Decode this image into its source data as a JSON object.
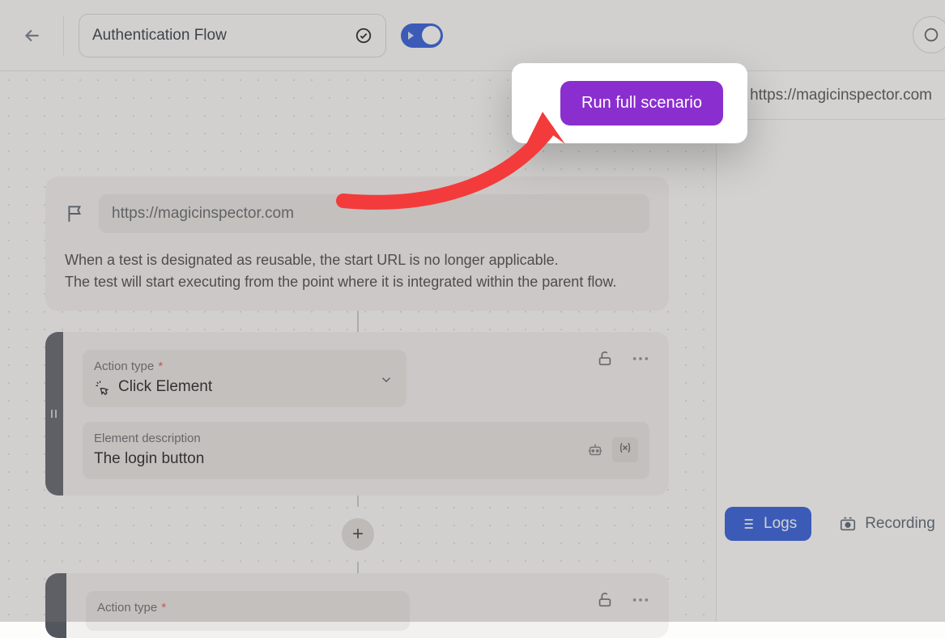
{
  "header": {
    "title": "Authentication Flow"
  },
  "start_card": {
    "url": "https://magicinspector.com",
    "description_line1": "When a test is designated as reusable, the start URL is no longer applicable.",
    "description_line2": "The test will start executing from the point where it is integrated within the parent flow."
  },
  "step1": {
    "action_label": "Action type",
    "action_value": "Click Element",
    "element_label": "Element description",
    "element_value": "The login button"
  },
  "step2": {
    "action_label": "Action type"
  },
  "sidebar": {
    "url": "https://magicinspector.com",
    "logs_tab": "Logs",
    "recording_tab": "Recording"
  },
  "popover": {
    "run_button": "Run full scenario"
  }
}
